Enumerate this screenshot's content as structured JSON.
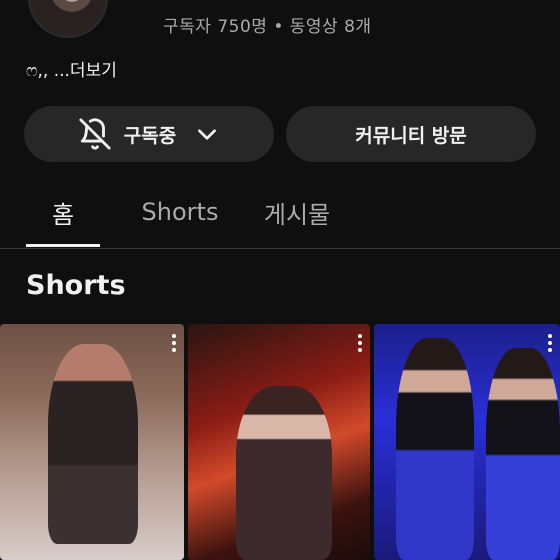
{
  "channel": {
    "stats": "구독자 750명 • 동영상 8개",
    "description": "ෆ,, ...더보기"
  },
  "buttons": {
    "subscribe_label": "구독중",
    "visit_label": "커뮤니티 방문"
  },
  "tabs": [
    {
      "label": "홈",
      "active": true
    },
    {
      "label": "Shorts",
      "active": false
    },
    {
      "label": "게시물",
      "active": false
    }
  ],
  "section": {
    "title": "Shorts"
  },
  "colors": {
    "background": "#0f0f0f",
    "button": "#272727",
    "text_primary": "#f1f1f1",
    "text_secondary": "#aaaaaa"
  },
  "icons": {
    "subscribe": "bell-off-icon",
    "dropdown": "chevron-down-icon",
    "thumbnail_menu": "more-vert-icon"
  }
}
